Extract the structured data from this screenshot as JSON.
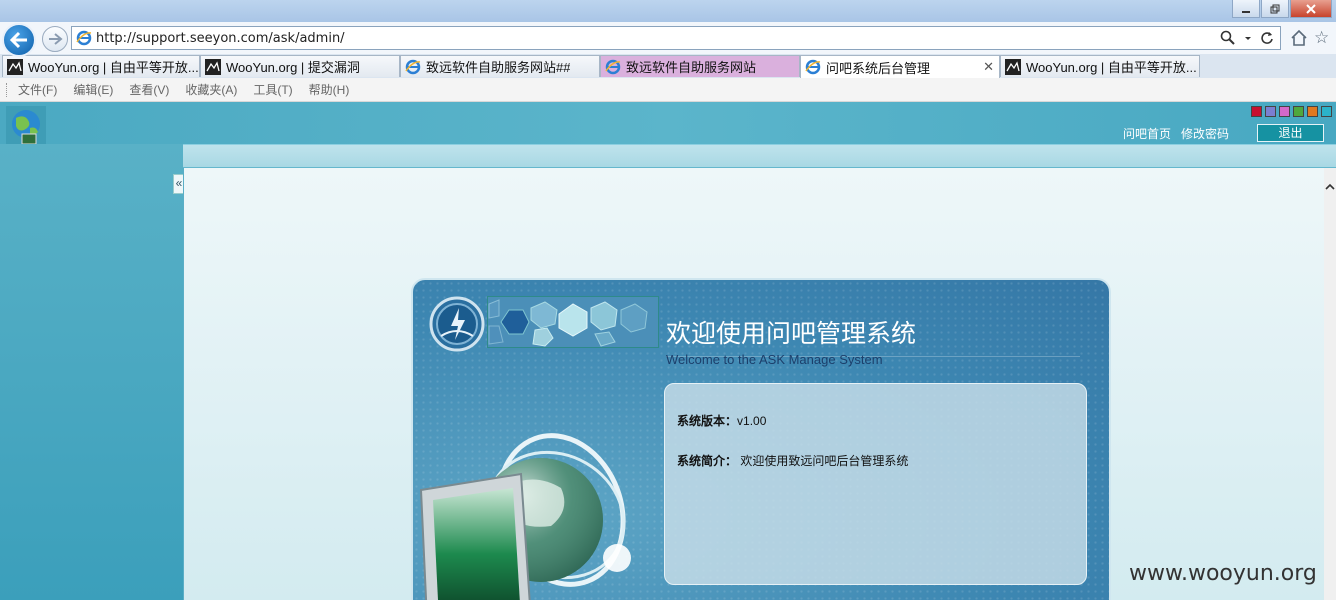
{
  "browser": {
    "url": "http://support.seeyon.com/ask/admin/",
    "tabs": [
      {
        "label": "WooYun.org | 自由平等开放...",
        "icon": "wooyun-favicon-icon",
        "state": "normal"
      },
      {
        "label": "WooYun.org | 提交漏洞",
        "icon": "wooyun-favicon-icon",
        "state": "normal"
      },
      {
        "label": "致远软件自助服务网站##",
        "icon": "ie-page-icon",
        "state": "normal"
      },
      {
        "label": "致远软件自助服务网站",
        "icon": "ie-page-icon",
        "state": "highlighted"
      },
      {
        "label": "问吧系统后台管理",
        "icon": "ie-page-icon",
        "state": "active"
      },
      {
        "label": "WooYun.org | 自由平等开放...",
        "icon": "wooyun-favicon-icon",
        "state": "normal"
      }
    ],
    "menu": [
      "文件(F)",
      "编辑(E)",
      "查看(V)",
      "收藏夹(A)",
      "工具(T)",
      "帮助(H)"
    ],
    "tab_close_glyph": "✕"
  },
  "app": {
    "skin_colors": [
      "#c8102e",
      "#7b7fd1",
      "#d569c9",
      "#4fa83d",
      "#e07820",
      "#2bb2c9"
    ],
    "top_links": [
      "问吧首页",
      "修改密码"
    ],
    "logout_label": "退出",
    "collapse_glyph": "«"
  },
  "welcome": {
    "title": "欢迎使用问吧管理系统",
    "subtitle": "Welcome to the ASK Manage System",
    "version_label": "系统版本：",
    "version_value": "v1.00",
    "intro_label": "系统简介：",
    "intro_value": " 欢迎使用致远问吧后台管理系统"
  },
  "watermark": "www.wooyun.org"
}
